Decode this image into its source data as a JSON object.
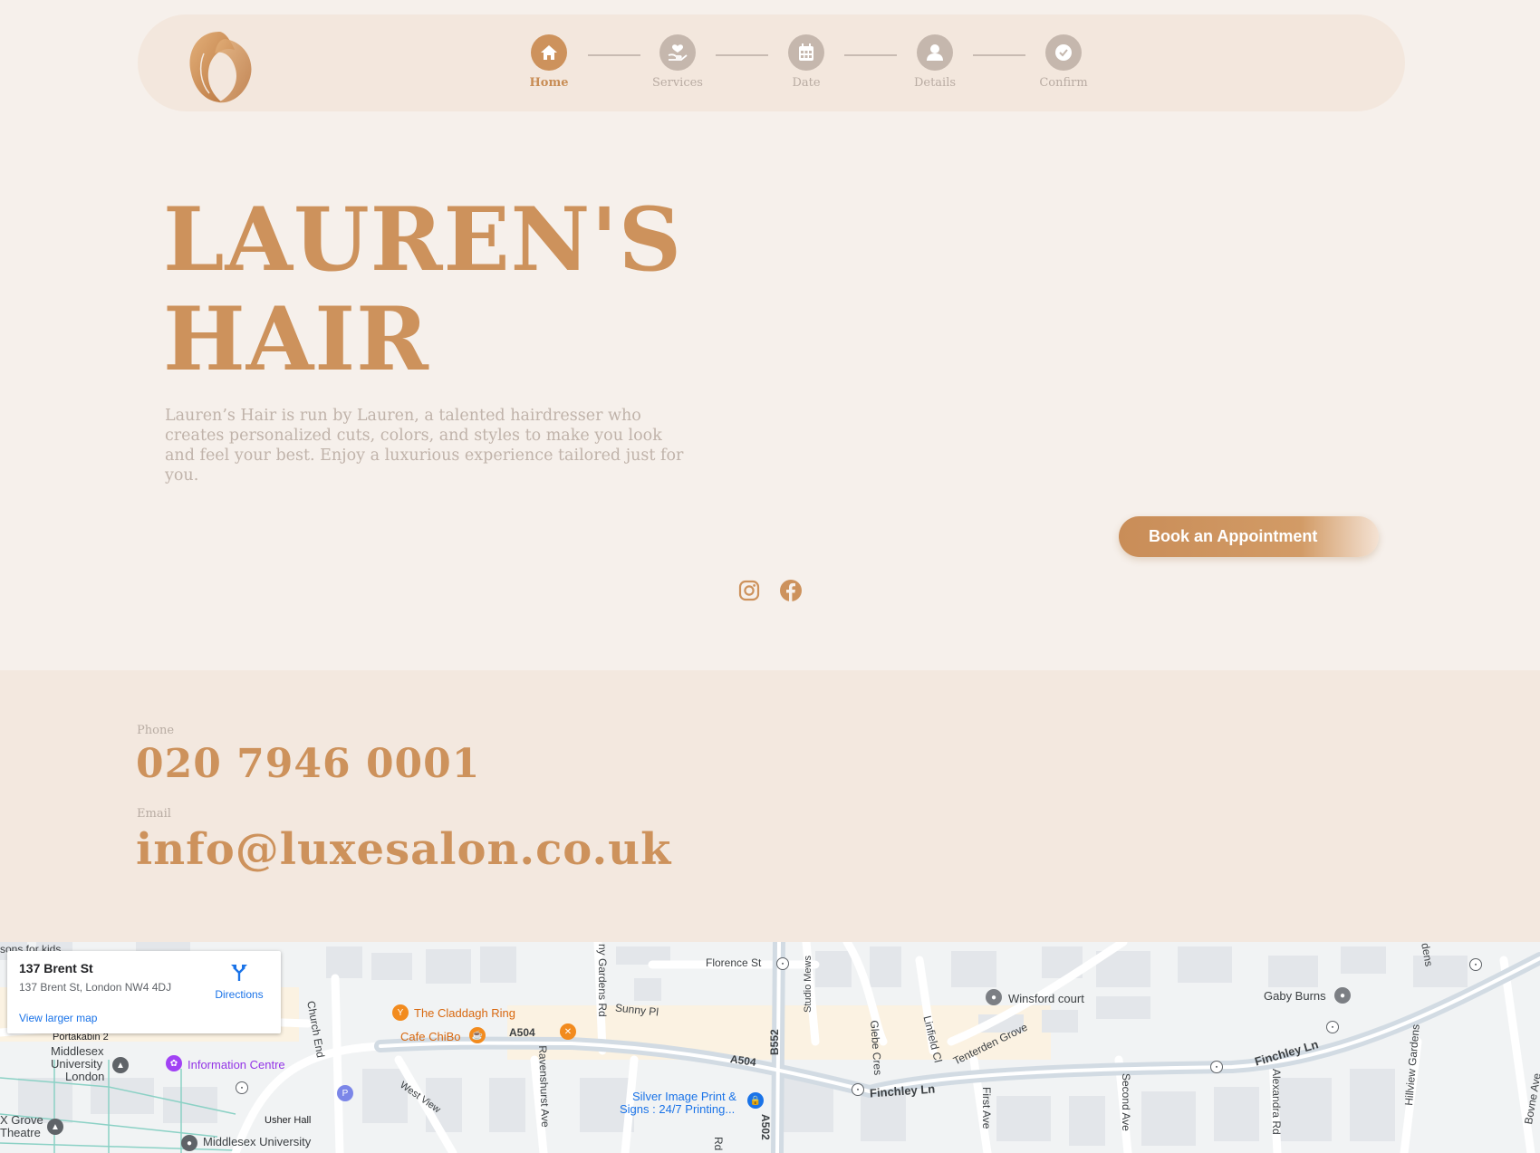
{
  "header": {
    "logo": "hair-logo",
    "steps": [
      {
        "label": "Home",
        "icon": "home-icon",
        "active": true
      },
      {
        "label": "Services",
        "icon": "hand-heart-icon",
        "active": false
      },
      {
        "label": "Date",
        "icon": "calendar-icon",
        "active": false
      },
      {
        "label": "Details",
        "icon": "user-icon",
        "active": false
      },
      {
        "label": "Confirm",
        "icon": "check-circle-icon",
        "active": false
      }
    ]
  },
  "hero": {
    "title_line1": "LAUREN'S",
    "title_line2": "HAIR",
    "description": "Lauren’s Hair is run by Lauren, a talented hairdresser who creates personalized cuts, colors, and styles to make you look and feel your best. Enjoy a luxurious experience tailored just for you.",
    "cta_label": "Book an Appointment",
    "social": [
      "instagram-icon",
      "facebook-icon"
    ]
  },
  "contact": {
    "phone_label": "Phone",
    "phone": "020 7946 0001",
    "email_label": "Email",
    "email": "info@luxesalon.co.uk"
  },
  "map": {
    "card": {
      "title": "137 Brent St",
      "address": "137 Brent St, London NW4 4DJ",
      "directions": "Directions",
      "larger_map": "View larger map"
    },
    "labels": {
      "kids": "sons for kids",
      "portakabin": "Portakabin 2",
      "mdx1": "Middlesex",
      "mdx2": "University",
      "mdx3": "London",
      "info": "Information Centre",
      "grove1": "X Grove",
      "grove2": "Theatre",
      "usher": "Usher Hall",
      "mdx_bottom": "Middlesex University",
      "church": "Church End",
      "westview": "West View",
      "claddagh": "The Claddagh Ring",
      "chibo": "Cafe ChiBo",
      "a504a": "A504",
      "a504b": "A504",
      "gardens": "ny Gardens Rd",
      "sunny": "Sunny Pl",
      "ravens": "Ravenshurst Ave",
      "florence": "Florence St",
      "studio": "Studio Mews",
      "b552": "B552",
      "a502": "A502",
      "silver1": "Silver Image Print &",
      "silver2": "Signs : 24/7 Printing...",
      "glebe": "Glebe Cres",
      "linfield": "Linfield Cl",
      "finchley1": "Finchley Ln",
      "finchley2": "Finchley Ln",
      "tenterden": "Tenterden Grove",
      "winsford": "Winsford court",
      "first": "First Ave",
      "second": "Second Ave",
      "alexandra": "Alexandra Rd",
      "hillview": "Hillview Gardens",
      "gaby": "Gaby Burns",
      "bovne": "Bovne Ave",
      "dens": "dens",
      "rd": "Rd",
      "p": "P"
    }
  }
}
